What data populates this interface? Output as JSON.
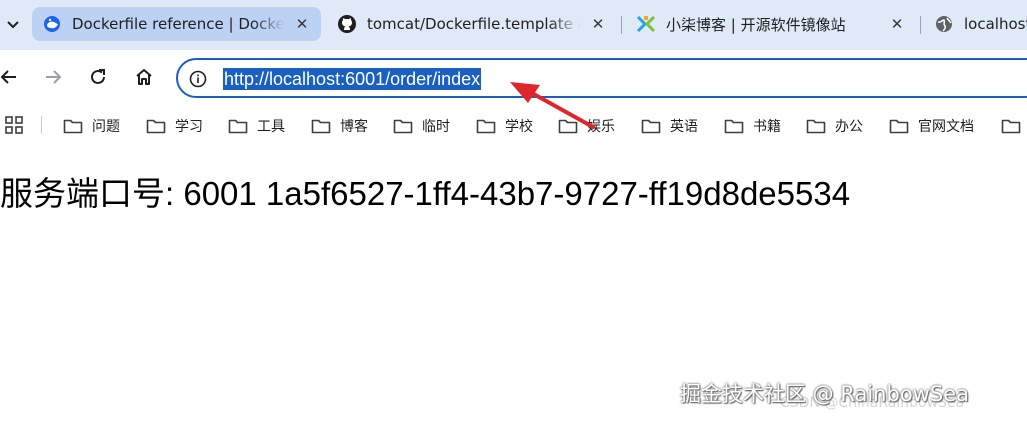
{
  "tabs": [
    {
      "title": "Dockerfile reference | Docker Docs",
      "favicon": "docker-docs-icon",
      "active": true
    },
    {
      "title": "tomcat/Dockerfile.template at master",
      "favicon": "github-icon",
      "active": false
    },
    {
      "title": "小柒博客 | 开源软件镜像站",
      "favicon": "xiaoqi-logo-icon",
      "active": false
    },
    {
      "title": "localhost",
      "favicon": "globe-icon",
      "active": false
    }
  ],
  "toolbar": {
    "url": "http://localhost:6001/order/index",
    "icons": [
      "back-arrow-icon",
      "forward-arrow-icon",
      "reload-icon",
      "home-icon",
      "info-icon"
    ]
  },
  "bookmarks": {
    "items": [
      "问题",
      "学习",
      "工具",
      "博客",
      "临时",
      "学校",
      "娱乐",
      "英语",
      "书籍",
      "办公",
      "官网文档",
      ""
    ]
  },
  "page": {
    "text": "服务端口号: 6001 1a5f6527-1ff4-43b7-9727-ff19d8de5534"
  },
  "overlay": {
    "watermark": "掘金技术社区 @ RainbowSea",
    "watermark_secondary": "CSDN @ChinaRainbowSea",
    "arrow_color": "#e0262a"
  },
  "colors": {
    "tabbar_bg": "#dfe9f8",
    "active_tab_bg": "#bcd2f5",
    "url_highlight": "#1a5fc2"
  }
}
